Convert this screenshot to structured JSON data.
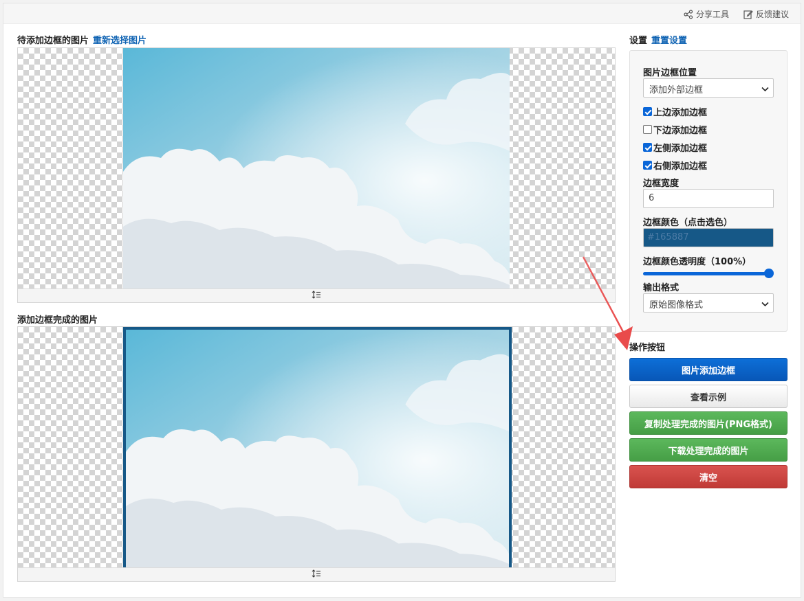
{
  "topbar": {
    "share_label": "分享工具",
    "feedback_label": "反馈建议"
  },
  "source": {
    "title": "待添加边框的图片",
    "reselect_label": "重新选择图片"
  },
  "result": {
    "title": "添加边框完成的图片"
  },
  "settings": {
    "title": "设置",
    "reset_label": "重置设置",
    "position_label": "图片边框位置",
    "position_value": "添加外部边框",
    "top_label": "上边添加边框",
    "top_checked": true,
    "bottom_label": "下边添加边框",
    "bottom_checked": false,
    "left_label": "左侧添加边框",
    "left_checked": true,
    "right_label": "右侧添加边框",
    "right_checked": true,
    "width_label": "边框宽度",
    "width_value": "6",
    "color_label": "边框颜色（点击选色）",
    "color_value": "#165887",
    "opacity_label": "边框颜色透明度（100%）",
    "opacity_value": 1.0,
    "format_label": "输出格式",
    "format_value": "原始图像格式"
  },
  "actions": {
    "title": "操作按钮",
    "add_border_label": "图片添加边框",
    "example_label": "查看示例",
    "copy_label": "复制处理完成的图片(PNG格式)",
    "download_label": "下载处理完成的图片",
    "clear_label": "清空"
  },
  "colors": {
    "link": "#0f63b3",
    "primary": "#0d6fd8",
    "success": "#5cb85c",
    "danger": "#d9534f",
    "border_color": "#165887",
    "annotation_arrow": "#e94b4b"
  }
}
